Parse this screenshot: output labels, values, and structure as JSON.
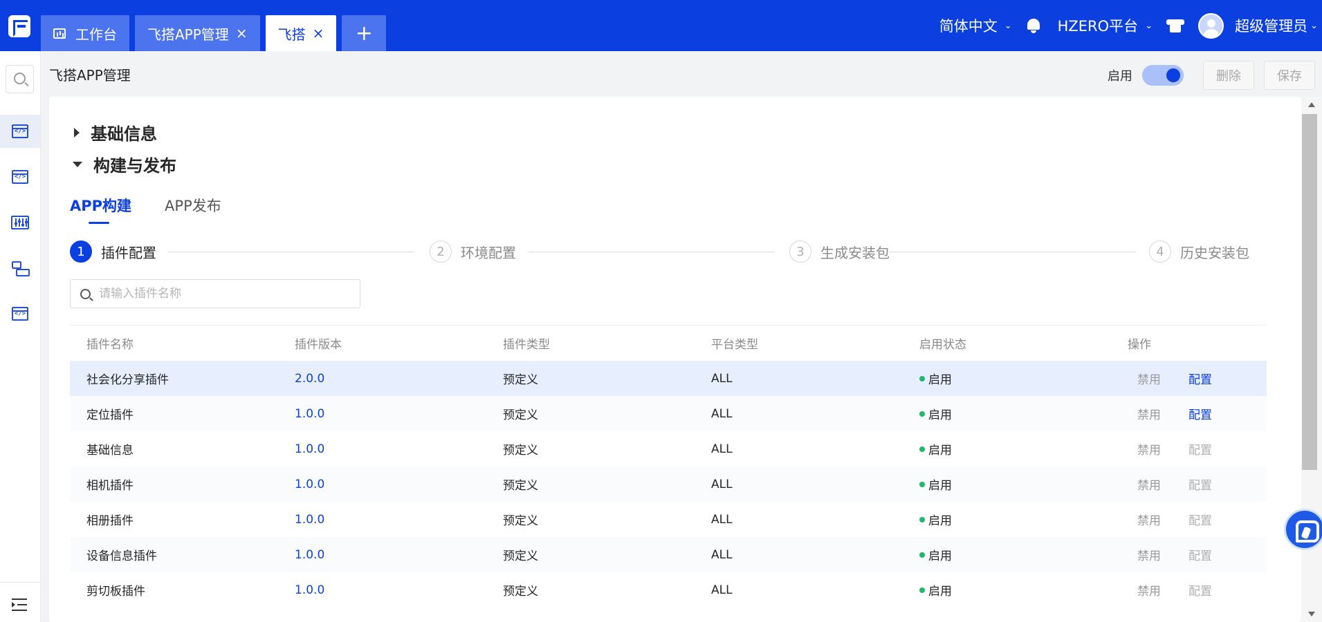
{
  "header": {
    "tabs": [
      {
        "label": "工作台"
      },
      {
        "label": "飞搭APP管理"
      },
      {
        "label": "飞搭"
      }
    ],
    "add_tab": "+",
    "close_glyph": "×",
    "language": "简体中文",
    "platform": "HZERO平台",
    "user": "超级管理员"
  },
  "page": {
    "title": "飞搭APP管理",
    "enable_label": "启用",
    "delete_label": "删除",
    "save_label": "保存"
  },
  "sections": {
    "basic": "基础信息",
    "build": "构建与发布"
  },
  "subtabs": [
    "APP构建",
    "APP发布"
  ],
  "steps": [
    {
      "num": "1",
      "label": "插件配置"
    },
    {
      "num": "2",
      "label": "环境配置"
    },
    {
      "num": "3",
      "label": "生成安装包"
    },
    {
      "num": "4",
      "label": "历史安装包"
    }
  ],
  "search": {
    "placeholder": "请输入插件名称"
  },
  "table": {
    "columns": [
      "插件名称",
      "插件版本",
      "插件类型",
      "平台类型",
      "启用状态",
      "操作"
    ],
    "rows": [
      {
        "name": "社会化分享插件",
        "version": "2.0.0",
        "type": "预定义",
        "platform": "ALL",
        "status": "启用",
        "op1": "禁用",
        "op2": "配置"
      },
      {
        "name": "定位插件",
        "version": "1.0.0",
        "type": "预定义",
        "platform": "ALL",
        "status": "启用",
        "op1": "禁用",
        "op2": "配置"
      },
      {
        "name": "基础信息",
        "version": "1.0.0",
        "type": "预定义",
        "platform": "ALL",
        "status": "启用",
        "op1": "禁用",
        "op2": "配置"
      },
      {
        "name": "相机插件",
        "version": "1.0.0",
        "type": "预定义",
        "platform": "ALL",
        "status": "启用",
        "op1": "禁用",
        "op2": "配置"
      },
      {
        "name": "相册插件",
        "version": "1.0.0",
        "type": "预定义",
        "platform": "ALL",
        "status": "启用",
        "op1": "禁用",
        "op2": "配置"
      },
      {
        "name": "设备信息插件",
        "version": "1.0.0",
        "type": "预定义",
        "platform": "ALL",
        "status": "启用",
        "op1": "禁用",
        "op2": "配置"
      },
      {
        "name": "剪切板插件",
        "version": "1.0.0",
        "type": "预定义",
        "platform": "ALL",
        "status": "启用",
        "op1": "禁用",
        "op2": "配置"
      }
    ]
  },
  "colors": {
    "brand": "#0b3fe0",
    "tab_inactive": "#4b74ee",
    "status_on": "#21b86a",
    "row_selected": "#e7efff"
  },
  "icons": [
    "search-icon",
    "code-icon",
    "slider-icon",
    "layout-icon",
    "menu-icon",
    "bell-icon",
    "shirt-icon",
    "avatar",
    "chat-icon"
  ]
}
